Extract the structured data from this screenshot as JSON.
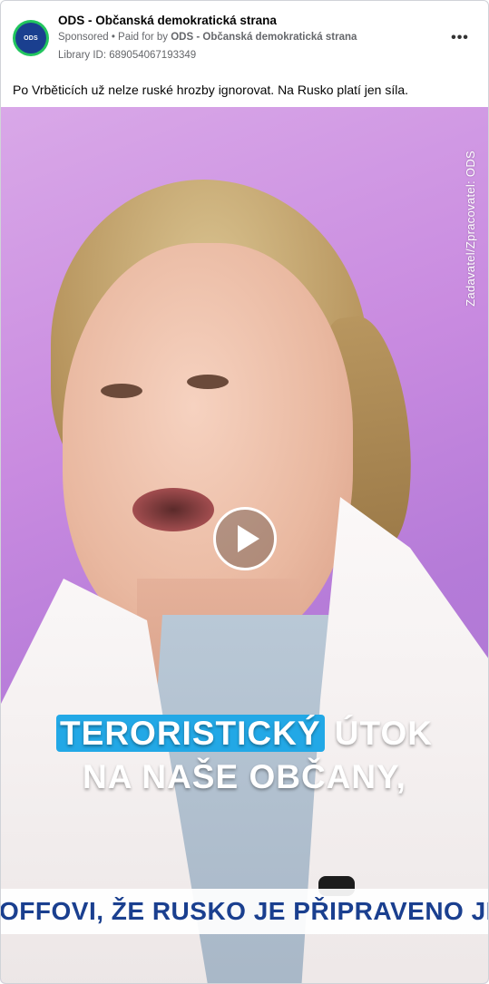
{
  "post": {
    "page_name": "ODS - Občanská demokratická strana",
    "sponsored_label": "Sponsored",
    "paid_for_prefix": "• Paid for by",
    "paid_for_name": "ODS - Občanská demokratická strana",
    "library_id": "Library ID: 689054067193349",
    "avatar_text": "ODS",
    "more_icon": "…",
    "ad_text": "Po Vrběticích už nelze ruské hrozby ignorovat. Na Rusko platí jen síla."
  },
  "video": {
    "watermark": "Zadavatel/Zpracovatel: ODS",
    "caption_highlight": "TERORISTICKÝ",
    "caption_rest_line1": " ÚTOK",
    "caption_line2": "NA NAŠE OBČANY,",
    "ticker": "OFFOVI, ŽE RUSKO JE PŘIPRAVENO JEDNAT S",
    "play_icon": "play-icon"
  },
  "colors": {
    "avatar_ring": "#22c55e",
    "avatar_fill": "#1a3f8f",
    "caption_highlight": "#22a8e6",
    "ticker_text": "#1a3f8f"
  }
}
